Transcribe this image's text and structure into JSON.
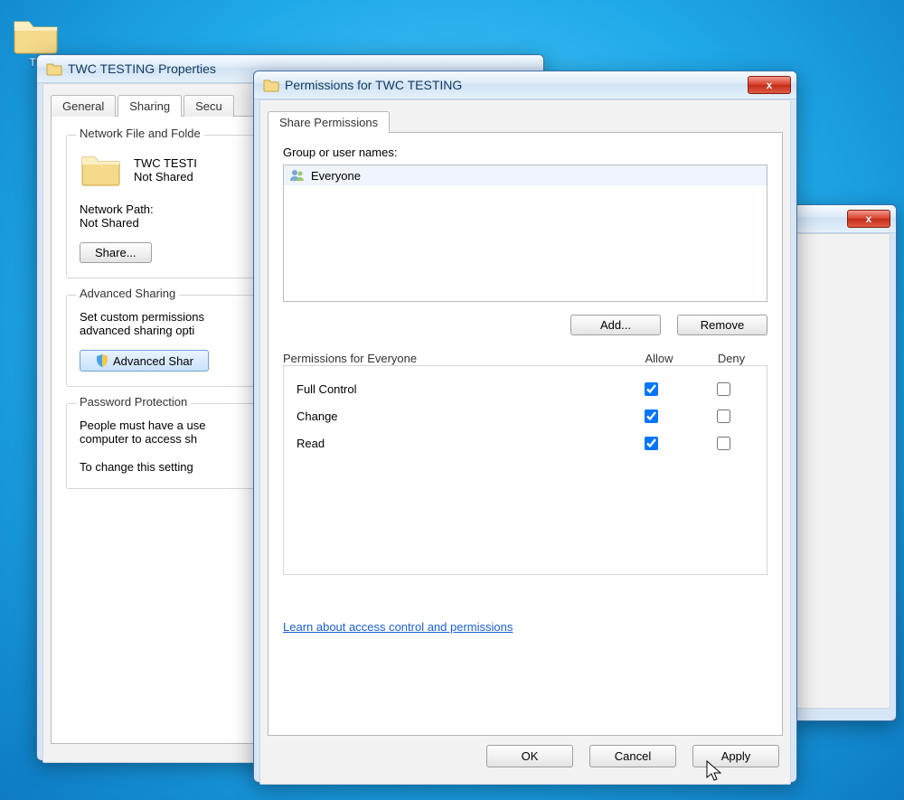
{
  "desktop_icons": [
    {
      "label": "TE"
    }
  ],
  "properties_window": {
    "title": "TWC TESTING Properties",
    "tabs": [
      "General",
      "Sharing",
      "Secu"
    ],
    "active_tab_index": 1,
    "sharing": {
      "section1_title": "Network File and Folde",
      "folder_name": "TWC TESTI",
      "folder_status": "Not Shared",
      "network_path_label": "Network Path:",
      "network_path_value": "Not Shared",
      "share_button": "Share..."
    },
    "advanced": {
      "title": "Advanced Sharing",
      "desc": "Set custom permissions\nadvanced sharing opti",
      "button": "Advanced Shar"
    },
    "password": {
      "title": "Password Protection",
      "line1": "People must have a use",
      "line2": "computer to access sh",
      "line3": "To change this setting"
    }
  },
  "permissions_window": {
    "title": "Permissions for TWC TESTING",
    "tab": "Share Permissions",
    "group_label": "Group or user names:",
    "user_entry": "Everyone",
    "add_button": "Add...",
    "remove_button": "Remove",
    "perm_header_label": "Permissions for Everyone",
    "col_allow": "Allow",
    "col_deny": "Deny",
    "permissions": [
      {
        "name": "Full Control",
        "allow": true,
        "deny": false
      },
      {
        "name": "Change",
        "allow": true,
        "deny": false
      },
      {
        "name": "Read",
        "allow": true,
        "deny": false
      }
    ],
    "learn_link": "Learn about access control and permissions",
    "buttons": {
      "ok": "OK",
      "cancel": "Cancel",
      "apply": "Apply"
    }
  }
}
